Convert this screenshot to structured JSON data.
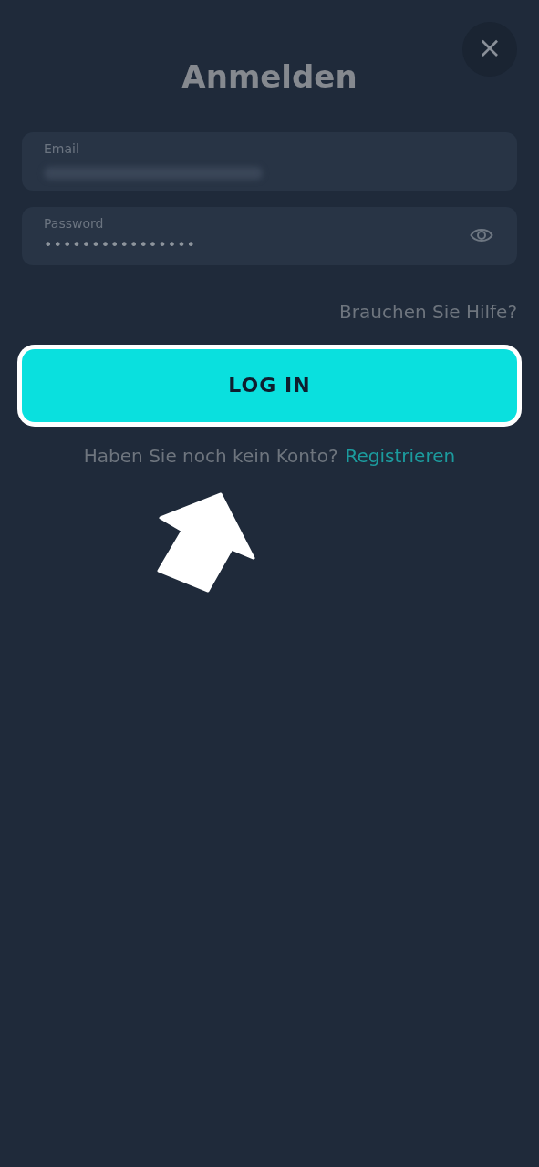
{
  "close_button": {
    "label": "×"
  },
  "title": "Anmelden",
  "fields": [
    {
      "label": "Email",
      "value_blurred": true
    },
    {
      "label": "Password",
      "value": "••••••••••••••••",
      "reveal_toggle": true
    }
  ],
  "help_link": "Brauchen Sie Hilfe?",
  "login_button": {
    "label": "LOG IN",
    "highlighted": true
  },
  "signup": {
    "text": "Haben Sie noch kein Konto?",
    "link": "Registrieren"
  },
  "pointer_arrow": true
}
